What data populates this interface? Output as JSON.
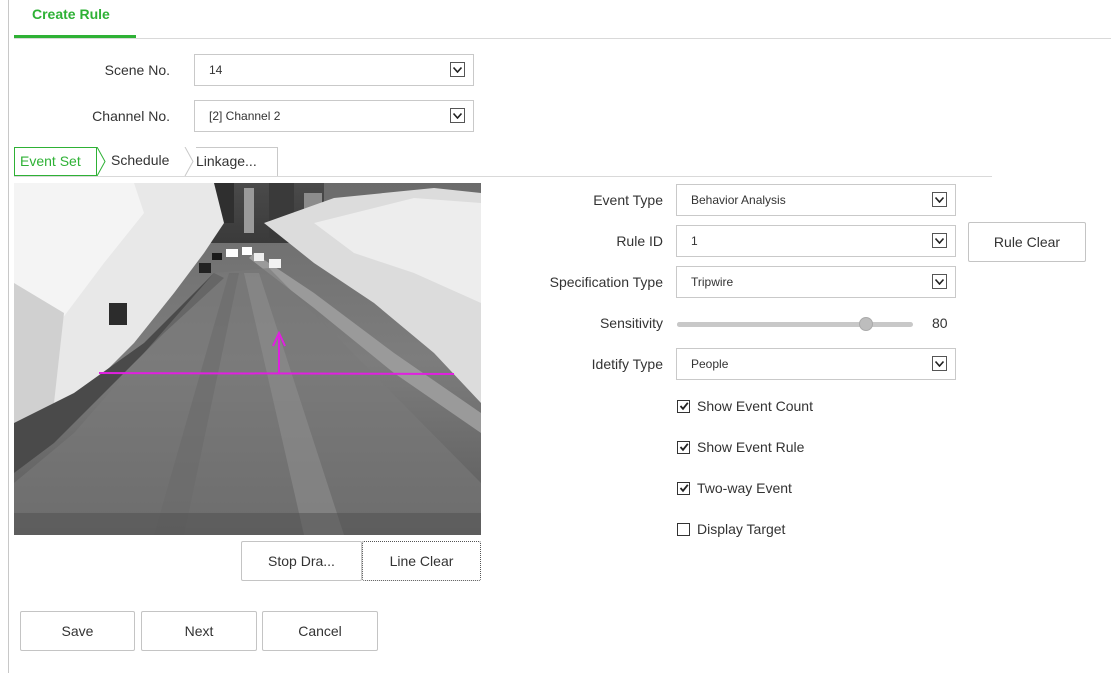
{
  "header": {
    "title": "Create Rule"
  },
  "scene": {
    "label": "Scene No.",
    "value": "14"
  },
  "channel": {
    "label": "Channel No.",
    "value": "[2] Channel 2"
  },
  "tabs": [
    {
      "label": "Event Set",
      "active": true
    },
    {
      "label": "Schedule",
      "active": false
    },
    {
      "label": "Linkage...",
      "active": false
    }
  ],
  "form": {
    "event_type": {
      "label": "Event Type",
      "value": "Behavior Analysis"
    },
    "rule_id": {
      "label": "Rule ID",
      "value": "1"
    },
    "rule_clear": "Rule Clear",
    "spec_type": {
      "label": "Specification Type",
      "value": "Tripwire"
    },
    "sensitivity": {
      "label": "Sensitivity",
      "value": "80",
      "level": 0.8
    },
    "identify_type": {
      "label": "Idetify Type",
      "value": "People"
    },
    "checks": [
      {
        "label": "Show Event Count",
        "checked": true
      },
      {
        "label": "Show Event Rule",
        "checked": true
      },
      {
        "label": "Two-way Event",
        "checked": true
      },
      {
        "label": "Display Target",
        "checked": false
      }
    ]
  },
  "video_buttons": {
    "stop_draw": "Stop Dra...",
    "line_clear": "Line Clear"
  },
  "footer": {
    "save": "Save",
    "next": "Next",
    "cancel": "Cancel"
  },
  "colors": {
    "accent": "#2eb135",
    "tripwire": "#e020e0"
  }
}
